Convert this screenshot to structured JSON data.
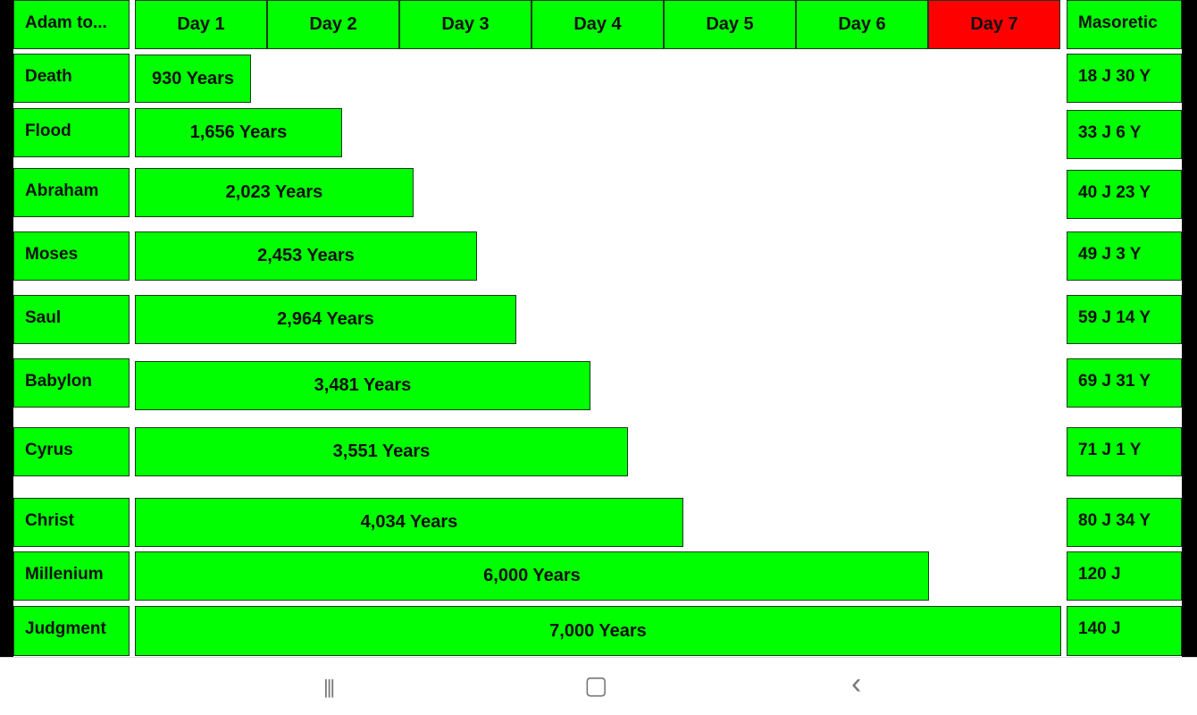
{
  "header": {
    "corner": "Adam to...",
    "days": [
      "Day 1",
      "Day 2",
      "Day 3",
      "Day 4",
      "Day 5",
      "Day 6",
      "Day 7"
    ],
    "right": "Masoretic",
    "highlight_day": "Day 7",
    "highlight_color": "#ff0000",
    "bar_color": "#00ff00"
  },
  "rows": [
    {
      "label": "Death",
      "years": "930 Years",
      "masoretic": "18 J 30 Y"
    },
    {
      "label": "Flood",
      "years": "1,656 Years",
      "masoretic": "33 J 6 Y"
    },
    {
      "label": "Abraham",
      "years": "2,023 Years",
      "masoretic": "40 J 23 Y"
    },
    {
      "label": "Moses",
      "years": "2,453 Years",
      "masoretic": "49 J 3 Y"
    },
    {
      "label": "Saul",
      "years": "2,964 Years",
      "masoretic": "59 J 14 Y"
    },
    {
      "label": "Babylon",
      "years": "3,481 Years",
      "masoretic": "69 J 31 Y"
    },
    {
      "label": "Cyrus",
      "years": "3,551 Years",
      "masoretic": "71 J 1 Y"
    },
    {
      "label": "Christ",
      "years": "4,034 Years",
      "masoretic": "80 J 34 Y"
    },
    {
      "label": "Millenium",
      "years": "6,000 Years",
      "masoretic": "120 J"
    },
    {
      "label": "Judgment",
      "years": "7,000 Years",
      "masoretic": "140 J"
    }
  ],
  "navbar": {
    "recents": "|||",
    "home": "▢",
    "back": "‹"
  }
}
